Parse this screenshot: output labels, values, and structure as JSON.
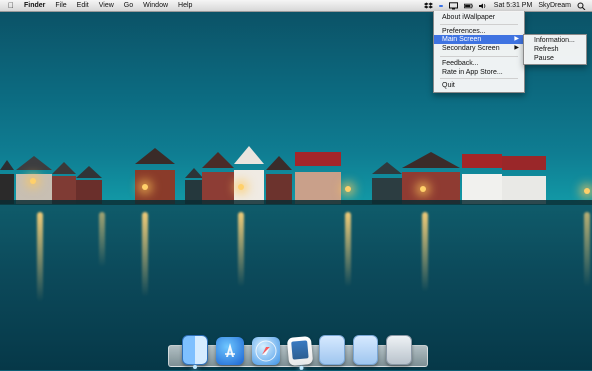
{
  "menubar": {
    "apple_icon": "apple-icon",
    "app_name": "Finder",
    "menus": [
      "File",
      "Edit",
      "View",
      "Go",
      "Window",
      "Help"
    ],
    "status": {
      "clock": "Sat 5:31 PM",
      "user": "SkyDream",
      "search_icon": "magnifying-glass-icon"
    }
  },
  "dropdown": {
    "items": [
      {
        "label": "About iWallpaper"
      },
      {
        "label": "Preferences..."
      },
      {
        "label": "Main Screen"
      },
      {
        "label": "Secondary Screen"
      },
      {
        "label": "Feedback..."
      },
      {
        "label": "Rate in App Store..."
      },
      {
        "label": "Quit"
      }
    ],
    "submenu": {
      "items": [
        {
          "label": "Information..."
        },
        {
          "label": "Refresh"
        },
        {
          "label": "Pause"
        }
      ]
    }
  },
  "dock": {
    "items": [
      {
        "name": "Finder"
      },
      {
        "name": "App Store"
      },
      {
        "name": "Safari"
      },
      {
        "name": "iWallpaper"
      },
      {
        "name": "Applications"
      },
      {
        "name": "Documents"
      },
      {
        "name": "Trash"
      }
    ]
  }
}
